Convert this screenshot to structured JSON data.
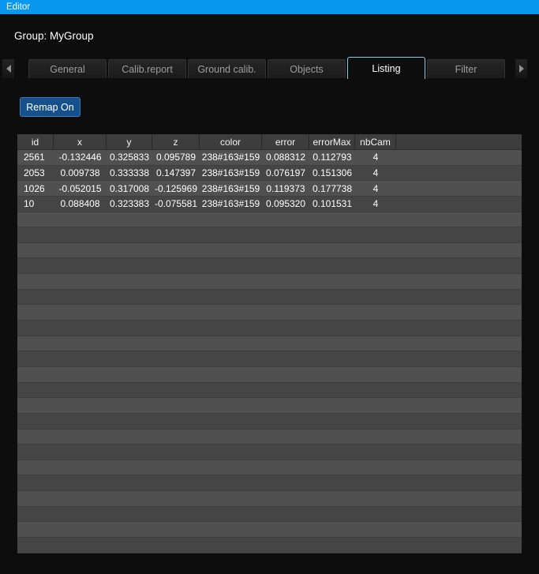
{
  "window": {
    "title": "Editor"
  },
  "header": {
    "group_label": "Group: MyGroup"
  },
  "tabs": {
    "items": [
      {
        "id": "general",
        "label": "General",
        "active": false
      },
      {
        "id": "calib-report",
        "label": "Calib.report",
        "active": false
      },
      {
        "id": "ground-calib",
        "label": "Ground calib.",
        "active": false
      },
      {
        "id": "objects",
        "label": "Objects",
        "active": false
      },
      {
        "id": "listing",
        "label": "Listing",
        "active": true
      },
      {
        "id": "filter",
        "label": "Filter",
        "active": false
      }
    ],
    "scroll_left_icon": "left-triangle",
    "scroll_right_icon": "right-triangle"
  },
  "toolbar": {
    "remap_button_label": "Remap On"
  },
  "table": {
    "columns": [
      "id",
      "x",
      "y",
      "z",
      "color",
      "error",
      "errorMax",
      "nbCam"
    ],
    "rows": [
      [
        "2561",
        "-0.132446",
        "0.325833",
        "0.095789",
        "238#163#159",
        "0.088312",
        "0.112793",
        "4"
      ],
      [
        "2053",
        "0.009738",
        "0.333338",
        "0.147397",
        "238#163#159",
        "0.076197",
        "0.151306",
        "4"
      ],
      [
        "1026",
        "-0.052015",
        "0.317008",
        "-0.125969",
        "238#163#159",
        "0.119373",
        "0.177738",
        "4"
      ],
      [
        "10",
        "0.088408",
        "0.323383",
        "-0.075581",
        "238#163#159",
        "0.095320",
        "0.101531",
        "4"
      ]
    ]
  },
  "colors": {
    "background": "#0d0d0e",
    "titlebar": "#0a97f0",
    "accent_button": "#15508c",
    "accent_button_border": "#3d7ab5",
    "active_tab_border": "#9cc3e0",
    "header_bg": "#3d3d3d",
    "row_light": "#505050",
    "row_dark": "#454545"
  }
}
